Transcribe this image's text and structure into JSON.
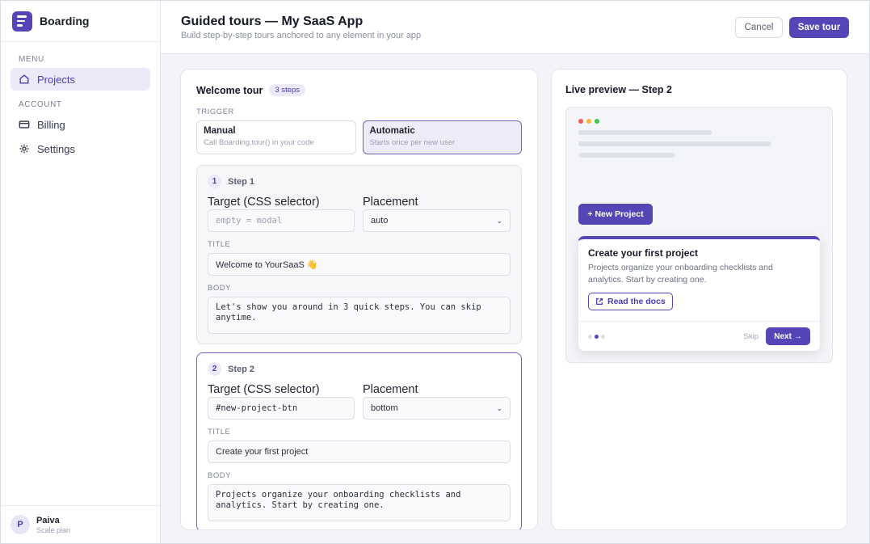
{
  "app": {
    "name": "Boarding"
  },
  "sidebar": {
    "menu_label": "MENU",
    "account_label": "ACCOUNT",
    "items": [
      {
        "label": "Projects",
        "icon": "home-icon",
        "active": true
      },
      {
        "label": "Billing",
        "icon": "card-icon",
        "active": false
      },
      {
        "label": "Settings",
        "icon": "gear-icon",
        "active": false
      }
    ],
    "user": {
      "initial": "P",
      "name": "Paiva",
      "plan": "Scale plan"
    }
  },
  "header": {
    "title": "Guided tours — My SaaS App",
    "subtitle": "Build step-by-step tours anchored to any element in your app",
    "cancel_label": "Cancel",
    "save_label": "Save tour"
  },
  "editor": {
    "tour_name": "Welcome tour",
    "steps_badge": "3 steps",
    "trigger_label": "TRIGGER",
    "triggers": [
      {
        "title": "Manual",
        "desc": "Call Boarding.tour() in your code",
        "selected": false
      },
      {
        "title": "Automatic",
        "desc": "Starts once per new user",
        "selected": true
      }
    ],
    "steps": [
      {
        "num": "1",
        "title": "Step 1",
        "target_label": "Target (CSS selector)",
        "target_value": "",
        "target_placeholder": "empty = modal",
        "placement_label": "Placement",
        "placement_value": "auto",
        "title_label": "TITLE",
        "title_value": "Welcome to YourSaaS 👋",
        "body_label": "BODY",
        "body_value": "Let's show you around in 3 quick steps. You can skip anytime."
      },
      {
        "num": "2",
        "title": "Step 2",
        "target_label": "Target (CSS selector)",
        "target_value": "#new-project-btn",
        "target_placeholder": "",
        "placement_label": "Placement",
        "placement_value": "bottom",
        "title_label": "TITLE",
        "title_value": "Create your first project",
        "body_label": "BODY",
        "body_value": "Projects organize your onboarding checklists and analytics. Start by creating one."
      }
    ]
  },
  "preview": {
    "title": "Live preview — Step 2",
    "window_dots": [
      "#f05a4f",
      "#f5b83c",
      "#3cc84a"
    ],
    "new_project_label": "+ New Project",
    "popover": {
      "title": "Create your first project",
      "text": "Projects organize your onboarding checklists and analytics. Start by creating one.",
      "docs_label": "Read the docs",
      "skip_label": "Skip",
      "next_label": "Next →",
      "current_step": 2,
      "total_steps": 3
    }
  },
  "colors": {
    "accent": "#5546b8",
    "accent_soft": "#eceaf8"
  }
}
